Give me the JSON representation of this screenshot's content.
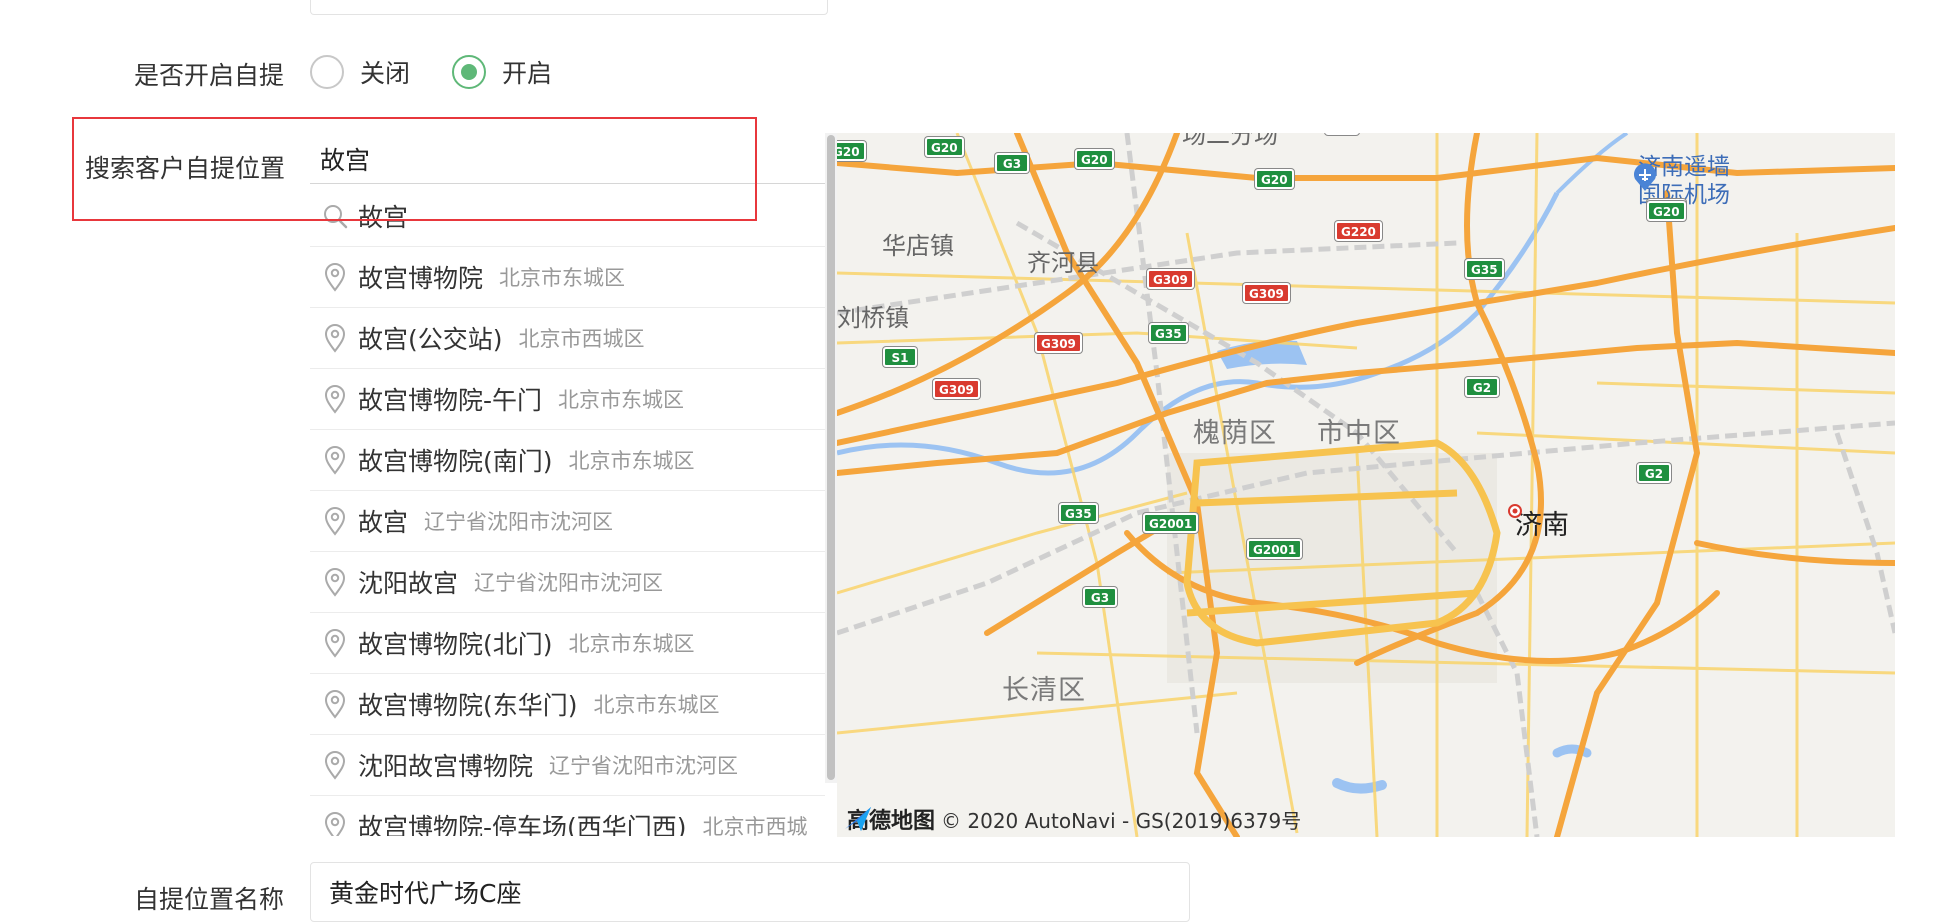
{
  "form": {
    "pickup_label": "是否开启自提",
    "options": [
      {
        "label": "关闭",
        "checked": false
      },
      {
        "label": "开启",
        "checked": true
      }
    ],
    "search_label": "搜索客户自提位置",
    "search_value": "故宫",
    "name_label": "自提位置名称",
    "name_value": "黄金时代广场C座"
  },
  "suggestions": {
    "keyword": "故宫",
    "items": [
      {
        "name": "故宫博物院",
        "address": "北京市东城区"
      },
      {
        "name": "故宫(公交站)",
        "address": "北京市西城区"
      },
      {
        "name": "故宫博物院-午门",
        "address": "北京市东城区"
      },
      {
        "name": "故宫博物院(南门)",
        "address": "北京市东城区"
      },
      {
        "name": "故宫",
        "address": "辽宁省沈阳市沈河区"
      },
      {
        "name": "沈阳故宫",
        "address": "辽宁省沈阳市沈河区"
      },
      {
        "name": "故宫博物院(北门)",
        "address": "北京市东城区"
      },
      {
        "name": "故宫博物院(东华门)",
        "address": "北京市东城区"
      },
      {
        "name": "沈阳故宫博物院",
        "address": "辽宁省沈阳市沈河区"
      },
      {
        "name": "故宫博物院-停车场(西华门西)",
        "address": "北京市西城"
      }
    ]
  },
  "map": {
    "labels": {
      "huadian": "华店镇",
      "qihe": "齐河县",
      "liuqiao": "刘桥镇",
      "huaiyin": "槐荫区",
      "shizhong": "市中区",
      "jinan": "济南",
      "changqing": "长清区",
      "airport_line1": "济南遥墙",
      "airport_line2": "国际机场",
      "top_fragment": "场二分场"
    },
    "shields": [
      "G20",
      "G20",
      "G3",
      "G20",
      "G2",
      "G20",
      "G220",
      "G20",
      "G35",
      "G309",
      "G309",
      "G35",
      "G309",
      "S1",
      "G309",
      "G2",
      "G35",
      "G2001",
      "G2001",
      "G2",
      "G3",
      "G20"
    ],
    "brand": "高德地图",
    "copyright": "© 2020 AutoNavi - GS(2019)6379号",
    "colors": {
      "highway": "#f5a53c",
      "road": "#f9d46b",
      "water": "#9cc3f2",
      "rail": "#c8c8c8"
    }
  },
  "theme": {
    "accent": "#5fb878",
    "highlight": "#e8373c"
  }
}
